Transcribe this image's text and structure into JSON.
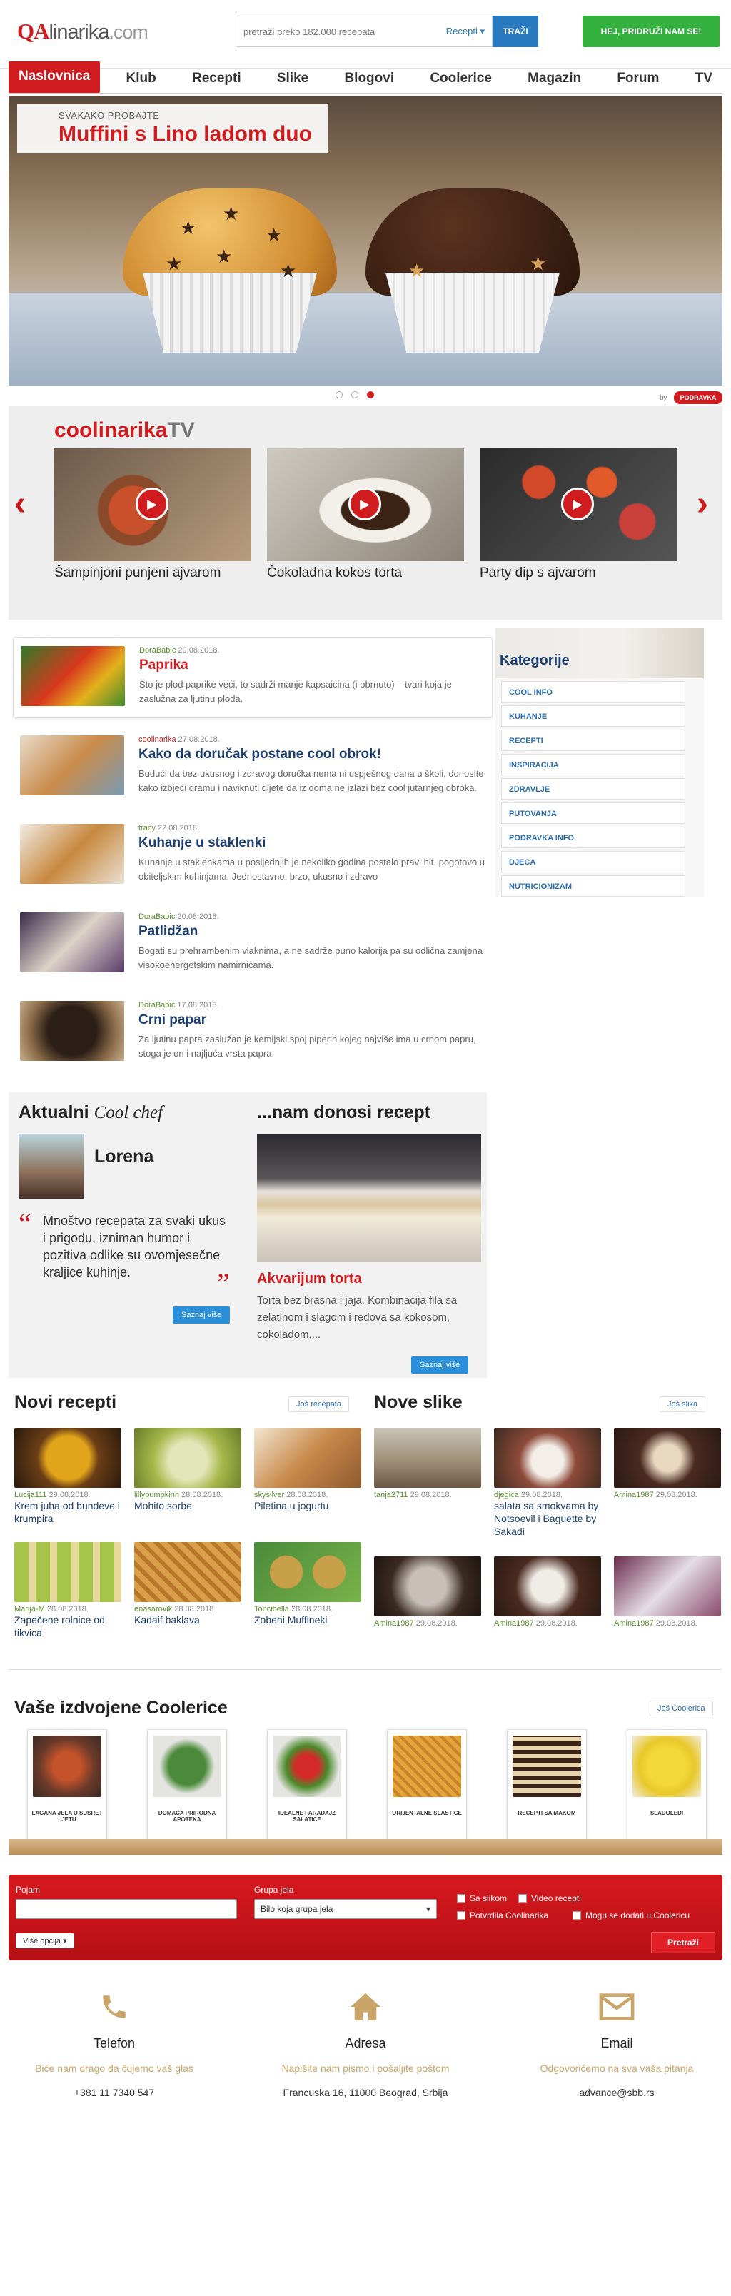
{
  "header": {
    "logo_qa": "QA",
    "logo_rest": "linarika",
    "logo_com": ".com",
    "search_placeholder": "pretraži preko 182.000 recepata",
    "search_scope": "Recepti ▾",
    "search_button": "TRAŽI",
    "join_button": "HEJ, PRIDRUŽI NAM SE!"
  },
  "nav": [
    {
      "label": "Naslovnica"
    },
    {
      "label": "Klub"
    },
    {
      "label": "Recepti"
    },
    {
      "label": "Slike"
    },
    {
      "label": "Blogovi"
    },
    {
      "label": "Coolerice"
    },
    {
      "label": "Magazin"
    },
    {
      "label": "Forum"
    },
    {
      "label": "TV"
    }
  ],
  "hero": {
    "pretitle": "SVAKAKO PROBAJTE",
    "title": "Muffini s Lino ladom duo",
    "by": "by",
    "sponsor": "PODRAVKA"
  },
  "tv": {
    "brand_a": "coolinarika",
    "brand_b": "TV",
    "items": [
      {
        "caption": "Šampinjoni punjeni ajvarom"
      },
      {
        "caption": "Čokoladna kokos torta"
      },
      {
        "caption": "Party dip s ajvarom"
      }
    ]
  },
  "articles": [
    {
      "author": "DoraBabic",
      "date": "29.08.2018.",
      "title": "Paprika",
      "desc": "Što je plod paprike veći, to sadrži manje kapsaicina (i obrnuto) – tvari koja je zaslužna za ljutinu ploda."
    },
    {
      "author": "coolinarika",
      "date": "27.08.2018.",
      "title": "Kako da doručak postane cool obrok!",
      "desc": "Budući da bez ukusnog i zdravog doručka nema ni uspješnog dana u školi, donosite kako izbjeći dramu i naviknuti dijete da iz doma ne izlazi bez cool jutarnjeg obroka."
    },
    {
      "author": "tracy",
      "date": "22.08.2018.",
      "title": "Kuhanje u staklenki",
      "desc": "Kuhanje u staklenkama u posljednjih je nekoliko godina postalo pravi hit, pogotovo u obiteljskim kuhinjama. Jednostavno, brzo, ukusno i zdravo"
    },
    {
      "author": "DoraBabic",
      "date": "20.08.2018.",
      "title": "Patlidžan",
      "desc": "Bogati su prehrambenim vlaknima, a ne sadrže puno kalorija pa su odlična zamjena visokoenergetskim namirnicama."
    },
    {
      "author": "DoraBabic",
      "date": "17.08.2018.",
      "title": "Crni papar",
      "desc": "Za ljutinu papra zaslužan je kemijski spoj piperin kojeg najviše ima u crnom papru, stoga je on i najljuća vrsta papra."
    }
  ],
  "categories": {
    "title": "Kategorije",
    "items": [
      "COOL INFO",
      "KUHANJE",
      "RECEPTI",
      "INSPIRACIJA",
      "ZDRAVLJE",
      "PUTOVANJA",
      "PODRAVKA INFO",
      "DJECA",
      "NUTRICIONIZAM"
    ]
  },
  "chef": {
    "heading_a": "Aktualni ",
    "heading_b": "Cool chef",
    "name": "Lorena",
    "quote": "Mnoštvo recepata za svaki ukus i prigodu, izniman humor i pozitiva odlike su ovomjesečne kraljice kuhinje.",
    "more": "Saznaj više",
    "recipe_heading": "...nam donosi recept",
    "recipe_title": "Akvarijum torta",
    "recipe_desc": "Torta bez brasna i jaja. Kombinacija fila sa zelatinom i slagom i redova sa kokosom, cokoladom,...",
    "recipe_more": "Saznaj više"
  },
  "novi_recepti": {
    "title": "Novi recepti",
    "more": "Još recepata",
    "items": [
      {
        "author": "Lucija111",
        "date": "29.08.2018.",
        "title": "Krem juha od bundeve i krumpira"
      },
      {
        "author": "lillypumpkinn",
        "date": "28.08.2018.",
        "title": "Mohito sorbe"
      },
      {
        "author": "skysilver",
        "date": "28.08.2018.",
        "title": "Piletina u jogurtu"
      },
      {
        "author": "Marija-M",
        "date": "28.08.2018.",
        "title": "Zapečene rolnice od tikvica"
      },
      {
        "author": "enasarovik",
        "date": "28.08.2018.",
        "title": "Kadaif baklava"
      },
      {
        "author": "Toncibella",
        "date": "28.08.2018.",
        "title": "Zobeni Muffineki"
      }
    ]
  },
  "nove_slike": {
    "title": "Nove slike",
    "more": "Još slika",
    "items": [
      {
        "author": "tanja2711",
        "date": "29.08.2018.",
        "title": ""
      },
      {
        "author": "djegica",
        "date": "29.08.2018.",
        "title": "salata sa smokvama by Notsoevil i Baguette by Sakadi"
      },
      {
        "author": "Amina1987",
        "date": "29.08.2018.",
        "title": ""
      },
      {
        "author": "Amina1987",
        "date": "29.08.2018.",
        "title": ""
      },
      {
        "author": "Amina1987",
        "date": "29.08.2018.",
        "title": ""
      },
      {
        "author": "Amina1987",
        "date": "29.08.2018.",
        "title": ""
      }
    ]
  },
  "coolerice": {
    "title": "Vaše izdvojene Coolerice",
    "more": "Još Coolerica",
    "books": [
      "LAGANA JELA U SUSRET LJETU",
      "DOMAĆA PRIRODNA APOTEKA",
      "IDEALNE PARADAJZ SALATICE",
      "ORIJENTALNE SLASTICE",
      "RECEPTI SA MAKOM",
      "SLADOLEDI"
    ]
  },
  "search_form": {
    "pojam_label": "Pojam",
    "grupa_label": "Grupa jela",
    "grupa_value": "Bilo koja grupa jela",
    "sa_slikom": "Sa slikom",
    "video": "Video recepti",
    "potvrdila": "Potvrdila Coolinarika",
    "mogu": "Mogu se dodati u Coolericu",
    "more": "Više opcija ▾",
    "submit": "Pretraži"
  },
  "contact": [
    {
      "icon": "phone-icon",
      "title": "Telefon",
      "sub": "Biće nam drago da čujemo vaš glas",
      "value": "+381 11 7340 547"
    },
    {
      "icon": "home-icon",
      "title": "Adresa",
      "sub": "Napišite nam pismo i pošaljite poštom",
      "value": "Francuska 16, 11000 Beograd, Srbija"
    },
    {
      "icon": "mail-icon",
      "title": "Email",
      "sub": "Odgovoričemo na sva vaša pitanja",
      "value": "advance@sbb.rs"
    }
  ],
  "colors": {
    "brand_red": "#d01c1f",
    "nav_blue": "#1c3f6e",
    "accent_green": "#34b03f",
    "link_blue": "#2a6db0",
    "gold": "#c9a56a"
  }
}
